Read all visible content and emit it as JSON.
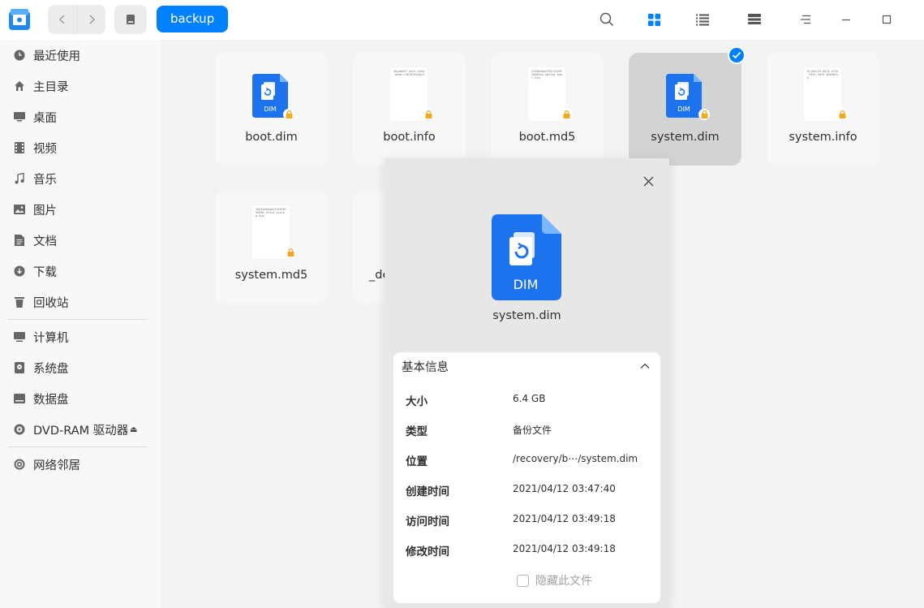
{
  "titlebar": {
    "breadcrumb": "backup",
    "icons": {
      "back": "chevron-left-icon",
      "forward": "chevron-right-icon",
      "disk": "disk-icon",
      "search": "search-icon",
      "icon_view": "grid-view-icon",
      "list_view": "list-view-icon",
      "tree_view": "tree-view-icon",
      "menu": "menu-icon",
      "minimize": "minimize-icon",
      "maximize": "maximize-icon"
    },
    "accent": "#0081ff"
  },
  "sidebar": {
    "items": [
      {
        "label": "最近使用",
        "icon": "clock-icon"
      },
      {
        "label": "主目录",
        "icon": "home-icon"
      },
      {
        "label": "桌面",
        "icon": "desktop-icon"
      },
      {
        "label": "视频",
        "icon": "video-icon"
      },
      {
        "label": "音乐",
        "icon": "music-icon"
      },
      {
        "label": "图片",
        "icon": "picture-icon"
      },
      {
        "label": "文档",
        "icon": "document-icon"
      },
      {
        "label": "下载",
        "icon": "download-icon"
      },
      {
        "label": "回收站",
        "icon": "trash-icon"
      },
      {
        "label": "计算机",
        "icon": "computer-icon"
      },
      {
        "label": "系统盘",
        "icon": "system-disk-icon"
      },
      {
        "label": "数据盘",
        "icon": "data-disk-icon"
      },
      {
        "label": "DVD-RAM 驱动器",
        "icon": "disc-icon"
      },
      {
        "label": "网络邻居",
        "icon": "network-icon"
      }
    ],
    "eject_symbol": "⏏"
  },
  "files": [
    {
      "name": "boot.dim",
      "type": "dim"
    },
    {
      "name": "boot.info",
      "type": "doc",
      "preview": "4b1ab63f-6ce7-4ebd-a0ab-f46767b5a0c3"
    },
    {
      "name": "boot.md5",
      "type": "doc",
      "preview": "37a9b6ba4794c1349f34d02ea ab47da boot.dim"
    },
    {
      "name": "system.dim",
      "type": "dim",
      "selected": true
    },
    {
      "name": "system.info",
      "type": "doc",
      "preview": "8c19e2f5-b0f4-4f3a-939c-3df6 4d4d0fab"
    },
    {
      "name": "system.md5",
      "type": "doc",
      "preview": "2b61a6b6ab4f1b976f9b99d 4f3c4 system.dim"
    },
    {
      "name": "_de",
      "type": "doc"
    }
  ],
  "panel": {
    "file_name": "system.dim",
    "icon_label": "DIM",
    "section_title": "基本信息",
    "hide_label": "隐藏此文件",
    "rows": [
      {
        "key": "大小",
        "value": "6.4 GB"
      },
      {
        "key": "类型",
        "value": "备份文件"
      },
      {
        "key": "位置",
        "value": "/recovery/b⋯/system.dim"
      },
      {
        "key": "创建时间",
        "value": "2021/04/12 03:47:40"
      },
      {
        "key": "访问时间",
        "value": "2021/04/12 03:49:18"
      },
      {
        "key": "修改时间",
        "value": "2021/04/12 03:49:18"
      }
    ]
  },
  "small_icon_label": "DIM"
}
